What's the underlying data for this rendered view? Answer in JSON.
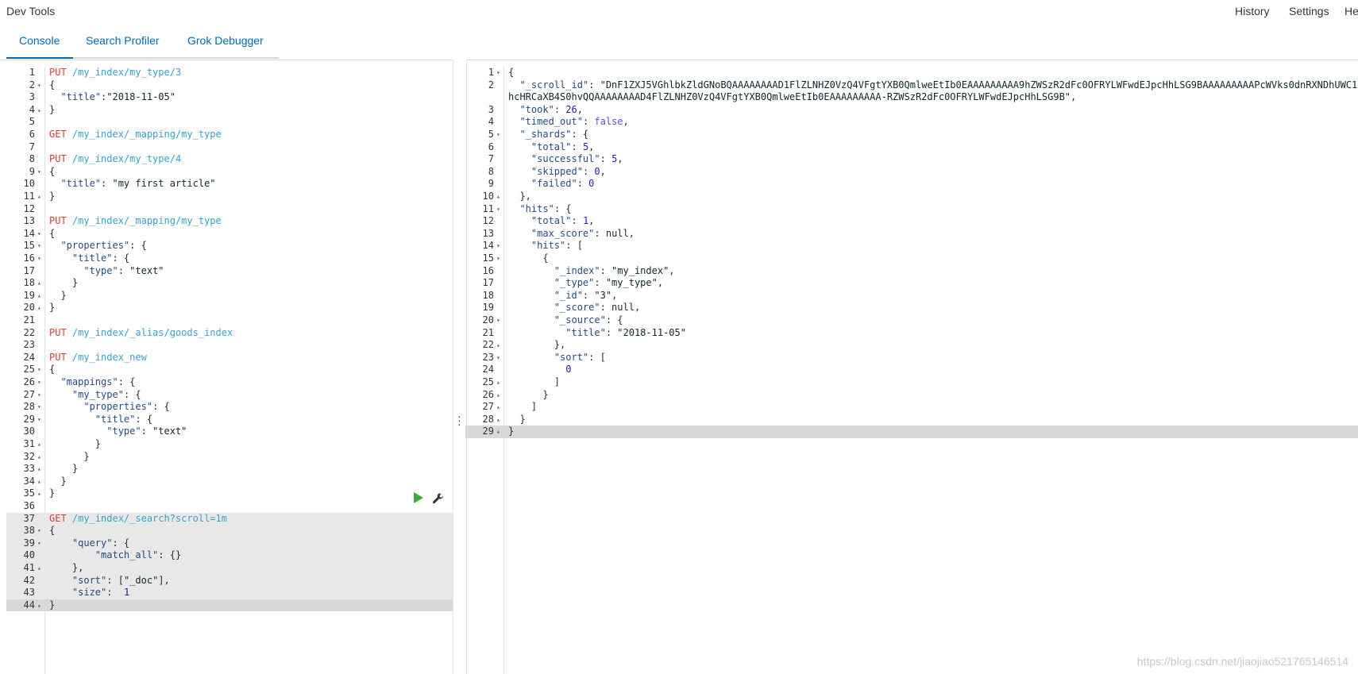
{
  "header": {
    "title": "Dev Tools",
    "links": [
      "History",
      "Settings",
      "He"
    ]
  },
  "tabs": [
    {
      "label": "Console",
      "active": true
    },
    {
      "label": "Search Profiler",
      "active": false
    },
    {
      "label": "Grok Debugger",
      "active": false
    }
  ],
  "editor": {
    "lines": [
      [
        [
          "kw",
          "PUT"
        ],
        [
          "url",
          " /my_index/my_type/3"
        ]
      ],
      [
        [
          "p",
          "{"
        ]
      ],
      [
        [
          "p",
          "  "
        ],
        [
          "k",
          "\"title\""
        ],
        [
          "p",
          ":"
        ],
        [
          "s",
          "\"2018-11-05\""
        ]
      ],
      [
        [
          "p",
          "}"
        ]
      ],
      [],
      [
        [
          "kw",
          "GET"
        ],
        [
          "url",
          " /my_index/_mapping/my_type"
        ]
      ],
      [],
      [
        [
          "kw",
          "PUT"
        ],
        [
          "url",
          " /my_index/my_type/4"
        ]
      ],
      [
        [
          "p",
          "{"
        ]
      ],
      [
        [
          "p",
          "  "
        ],
        [
          "k",
          "\"title\""
        ],
        [
          "p",
          ": "
        ],
        [
          "s",
          "\"my first article\""
        ]
      ],
      [
        [
          "p",
          "}"
        ]
      ],
      [],
      [
        [
          "kw",
          "PUT"
        ],
        [
          "url",
          " /my_index/_mapping/my_type"
        ]
      ],
      [
        [
          "p",
          "{"
        ]
      ],
      [
        [
          "p",
          "  "
        ],
        [
          "k",
          "\"properties\""
        ],
        [
          "p",
          ": {"
        ]
      ],
      [
        [
          "p",
          "    "
        ],
        [
          "k",
          "\"title\""
        ],
        [
          "p",
          ": {"
        ]
      ],
      [
        [
          "p",
          "      "
        ],
        [
          "k",
          "\"type\""
        ],
        [
          "p",
          ": "
        ],
        [
          "s",
          "\"text\""
        ]
      ],
      [
        [
          "p",
          "    }"
        ]
      ],
      [
        [
          "p",
          "  }"
        ]
      ],
      [
        [
          "p",
          "}"
        ]
      ],
      [],
      [
        [
          "kw",
          "PUT"
        ],
        [
          "url",
          " /my_index/_alias/goods_index"
        ]
      ],
      [],
      [
        [
          "kw",
          "PUT"
        ],
        [
          "url",
          " /my_index_new"
        ]
      ],
      [
        [
          "p",
          "{"
        ]
      ],
      [
        [
          "p",
          "  "
        ],
        [
          "k",
          "\"mappings\""
        ],
        [
          "p",
          ": {"
        ]
      ],
      [
        [
          "p",
          "    "
        ],
        [
          "k",
          "\"my_type\""
        ],
        [
          "p",
          ": {"
        ]
      ],
      [
        [
          "p",
          "      "
        ],
        [
          "k",
          "\"properties\""
        ],
        [
          "p",
          ": {"
        ]
      ],
      [
        [
          "p",
          "        "
        ],
        [
          "k",
          "\"title\""
        ],
        [
          "p",
          ": {"
        ]
      ],
      [
        [
          "p",
          "          "
        ],
        [
          "k",
          "\"type\""
        ],
        [
          "p",
          ": "
        ],
        [
          "s",
          "\"text\""
        ]
      ],
      [
        [
          "p",
          "        }"
        ]
      ],
      [
        [
          "p",
          "      }"
        ]
      ],
      [
        [
          "p",
          "    }"
        ]
      ],
      [
        [
          "p",
          "  }"
        ]
      ],
      [
        [
          "p",
          "}"
        ]
      ],
      [],
      [
        [
          "kw",
          "GET"
        ],
        [
          "url",
          " /my_index/_search?scroll=1m"
        ]
      ],
      [
        [
          "p",
          "{"
        ]
      ],
      [
        [
          "p",
          "    "
        ],
        [
          "k",
          "\"query\""
        ],
        [
          "p",
          ": {"
        ]
      ],
      [
        [
          "p",
          "        "
        ],
        [
          "k",
          "\"match_all\""
        ],
        [
          "p",
          ": {}"
        ]
      ],
      [
        [
          "p",
          "    },"
        ]
      ],
      [
        [
          "p",
          "    "
        ],
        [
          "k",
          "\"sort\""
        ],
        [
          "p",
          ": ["
        ],
        [
          "s",
          "\"_doc\""
        ],
        [
          "p",
          "],"
        ]
      ],
      [
        [
          "p",
          "    "
        ],
        [
          "k",
          "\"size\""
        ],
        [
          "p",
          ":  "
        ],
        [
          "n",
          "1"
        ]
      ],
      [
        [
          "p",
          "}"
        ]
      ]
    ],
    "fold_lines": [
      2,
      4,
      9,
      11,
      14,
      15,
      16,
      18,
      19,
      20,
      25,
      26,
      27,
      28,
      29,
      31,
      32,
      33,
      34,
      35,
      38,
      39,
      41,
      44
    ],
    "fold_up": [
      4,
      11,
      18,
      19,
      20,
      31,
      32,
      33,
      34,
      35,
      41,
      44
    ]
  },
  "output": {
    "lines": [
      [
        [
          "p",
          "{"
        ]
      ],
      [
        [
          "p",
          "  "
        ],
        [
          "k",
          "\"_scroll_id\""
        ],
        [
          "p",
          ": "
        ],
        [
          "s",
          "\"DnF1ZXJ5VGhlbkZldGNoBQAAAAAAAAD1FlZLNHZ0VzQ4VFgtYXB0QmlweEtIb0EAAAAAAAAA9hZWSzR2dFc0OFRYLWFwdEJpcHhLSG9BAAAAAAAAAPcWVks0dnRXNDhUWC1hcHRCaXB4S0hvQQAAAAAAAAD4FlZLNHZ0VzQ4VFgtYXB0QmlweEtIb0EAAAAAAAAA-RZWSzR2dFc0OFRYLWFwdEJpcHhLSG9B\""
        ],
        [
          "p",
          ","
        ]
      ],
      [
        [
          "p",
          "  "
        ],
        [
          "k",
          "\"took\""
        ],
        [
          "p",
          ": "
        ],
        [
          "n",
          "26"
        ],
        [
          "p",
          ","
        ]
      ],
      [
        [
          "p",
          "  "
        ],
        [
          "k",
          "\"timed_out\""
        ],
        [
          "p",
          ": "
        ],
        [
          "b",
          "false"
        ],
        [
          "p",
          ","
        ]
      ],
      [
        [
          "p",
          "  "
        ],
        [
          "k",
          "\"_shards\""
        ],
        [
          "p",
          ": {"
        ]
      ],
      [
        [
          "p",
          "    "
        ],
        [
          "k",
          "\"total\""
        ],
        [
          "p",
          ": "
        ],
        [
          "n",
          "5"
        ],
        [
          "p",
          ","
        ]
      ],
      [
        [
          "p",
          "    "
        ],
        [
          "k",
          "\"successful\""
        ],
        [
          "p",
          ": "
        ],
        [
          "n",
          "5"
        ],
        [
          "p",
          ","
        ]
      ],
      [
        [
          "p",
          "    "
        ],
        [
          "k",
          "\"skipped\""
        ],
        [
          "p",
          ": "
        ],
        [
          "n",
          "0"
        ],
        [
          "p",
          ","
        ]
      ],
      [
        [
          "p",
          "    "
        ],
        [
          "k",
          "\"failed\""
        ],
        [
          "p",
          ": "
        ],
        [
          "n",
          "0"
        ]
      ],
      [
        [
          "p",
          "  },"
        ]
      ],
      [
        [
          "p",
          "  "
        ],
        [
          "k",
          "\"hits\""
        ],
        [
          "p",
          ": {"
        ]
      ],
      [
        [
          "p",
          "    "
        ],
        [
          "k",
          "\"total\""
        ],
        [
          "p",
          ": "
        ],
        [
          "n",
          "1"
        ],
        [
          "p",
          ","
        ]
      ],
      [
        [
          "p",
          "    "
        ],
        [
          "k",
          "\"max_score\""
        ],
        [
          "p",
          ": null,"
        ]
      ],
      [
        [
          "p",
          "    "
        ],
        [
          "k",
          "\"hits\""
        ],
        [
          "p",
          ": ["
        ]
      ],
      [
        [
          "p",
          "      {"
        ]
      ],
      [
        [
          "p",
          "        "
        ],
        [
          "k",
          "\"_index\""
        ],
        [
          "p",
          ": "
        ],
        [
          "s",
          "\"my_index\""
        ],
        [
          "p",
          ","
        ]
      ],
      [
        [
          "p",
          "        "
        ],
        [
          "k",
          "\"_type\""
        ],
        [
          "p",
          ": "
        ],
        [
          "s",
          "\"my_type\""
        ],
        [
          "p",
          ","
        ]
      ],
      [
        [
          "p",
          "        "
        ],
        [
          "k",
          "\"_id\""
        ],
        [
          "p",
          ": "
        ],
        [
          "s",
          "\"3\""
        ],
        [
          "p",
          ","
        ]
      ],
      [
        [
          "p",
          "        "
        ],
        [
          "k",
          "\"_score\""
        ],
        [
          "p",
          ": null,"
        ]
      ],
      [
        [
          "p",
          "        "
        ],
        [
          "k",
          "\"_source\""
        ],
        [
          "p",
          ": {"
        ]
      ],
      [
        [
          "p",
          "          "
        ],
        [
          "k",
          "\"title\""
        ],
        [
          "p",
          ": "
        ],
        [
          "s",
          "\"2018-11-05\""
        ]
      ],
      [
        [
          "p",
          "        },"
        ]
      ],
      [
        [
          "p",
          "        "
        ],
        [
          "k",
          "\"sort\""
        ],
        [
          "p",
          ": ["
        ]
      ],
      [
        [
          "p",
          "          "
        ],
        [
          "n",
          "0"
        ]
      ],
      [
        [
          "p",
          "        ]"
        ]
      ],
      [
        [
          "p",
          "      }"
        ]
      ],
      [
        [
          "p",
          "    ]"
        ]
      ],
      [
        [
          "p",
          "  }"
        ]
      ],
      [
        [
          "p",
          "}"
        ]
      ]
    ],
    "fold_lines": [
      1,
      5,
      10,
      11,
      14,
      15,
      20,
      22,
      23,
      25,
      26,
      27,
      28,
      29
    ],
    "fold_up": [
      10,
      22,
      25,
      26,
      27,
      28,
      29
    ]
  },
  "watermark": "https://blog.csdn.net/jiaojiao521765146514",
  "colors": {
    "accent": "#006bb4",
    "method": "#d0412d",
    "url": "#3a9fd0",
    "play": "#3caa3c"
  },
  "icons": [
    "play-icon",
    "wrench-icon",
    "fold-arrow-icon",
    "splitter-handle-icon"
  ]
}
